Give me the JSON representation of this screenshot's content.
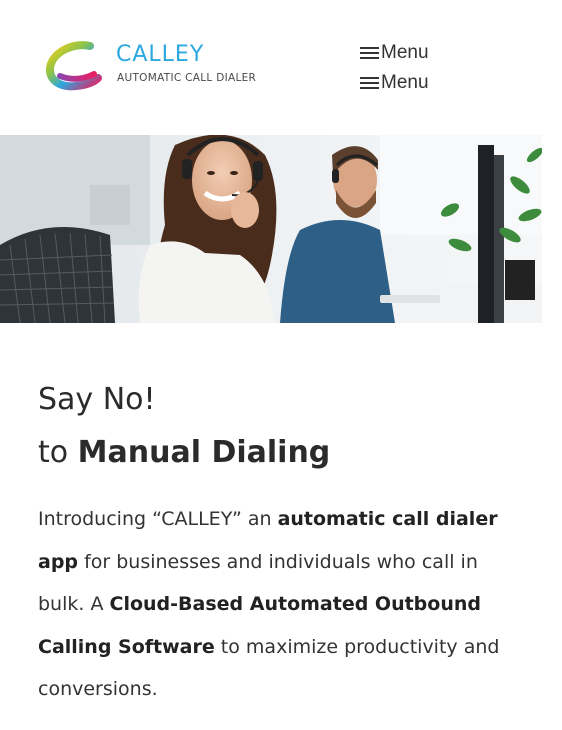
{
  "header": {
    "logo": {
      "name": "CALLEY",
      "tagline": "AUTOMATIC CALL DIALER"
    },
    "menu_buttons": [
      {
        "label": "Menu",
        "icon": "hamburger-icon"
      },
      {
        "label": "Menu",
        "icon": "hamburger-icon"
      }
    ]
  },
  "hero": {
    "image": "photo of smiling woman and bearded man wearing headsets in an office"
  },
  "main": {
    "headline": {
      "line1": "Say No!",
      "line2_prefix": "to",
      "line2_bold": "Manual Dialing"
    },
    "intro": {
      "p1": "Introducing “CALLEY” an ",
      "b1": "automatic call dialer app",
      "p2": " for businesses and individuals who call in bulk. A ",
      "b2": "Cloud-Based Automated Outbound Calling Software",
      "p3": " to maximize productivity and conversions."
    }
  },
  "colors": {
    "brand_blue": "#2ba8e0",
    "text": "#333333",
    "background": "#ffffff"
  }
}
